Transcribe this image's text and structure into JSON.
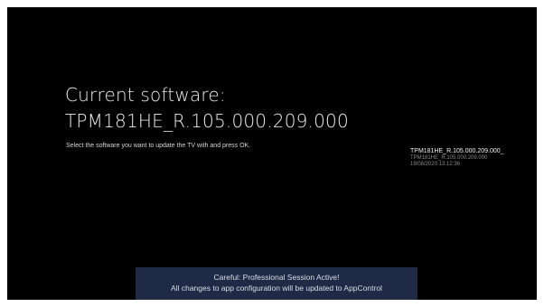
{
  "screen": {
    "title_line1": "Current software:",
    "title_line2": "TPM181HE_R.105.000.209.000",
    "instruction": "Select the software you want to update the TV with and press OK."
  },
  "software_list": {
    "items": [
      {
        "name": "TPM181HE_R.105.000.209.000_",
        "version": "TPM181HE_R.105.000.209.000",
        "date": "19/08/2020 13:12:36"
      }
    ]
  },
  "toast": {
    "line1": "Careful: Professional Session Active!",
    "line2": "All changes to app configuration will be updated to AppControl"
  },
  "colors": {
    "background": "#000000",
    "toast_background": "#1f2b46"
  }
}
